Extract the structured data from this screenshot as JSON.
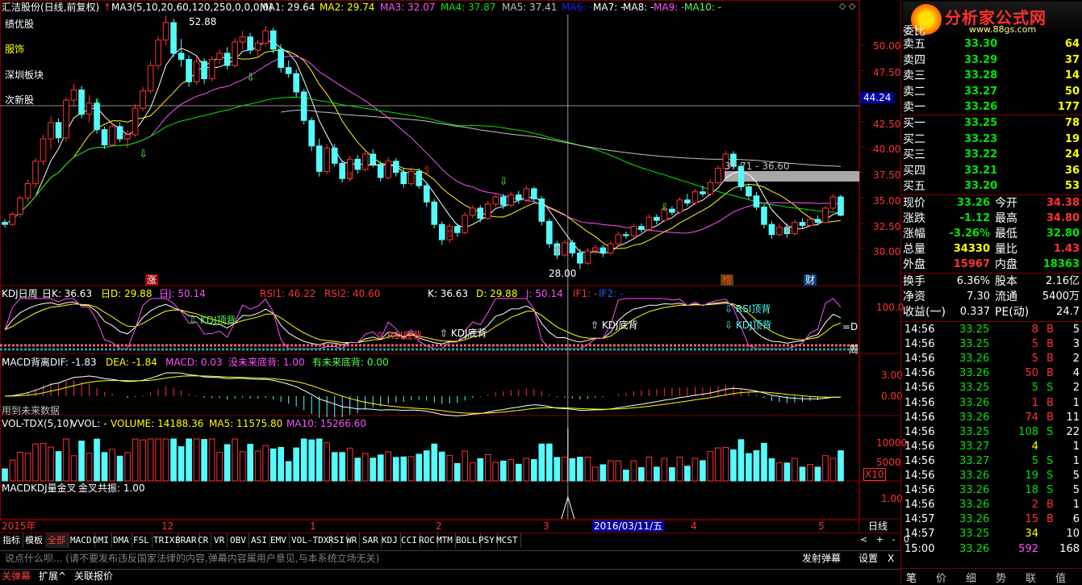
{
  "header": {
    "title": "汇洁股份(日线,前复权)",
    "ma_params": "MA3(5,10,20,60,120,250,0,0,0,0)",
    "ma1": "MA1: 29.64",
    "ma2": "MA2: 29.74",
    "ma3": "MA3: 32.07",
    "ma4": "MA4: 37.87",
    "ma5": "MA5: 37.41",
    "ma6": "MA6: -",
    "ma7": "MA7: -",
    "ma8": "MA8: -",
    "ma9": "MA9: -",
    "ma10": "MA10: -"
  },
  "sectors": [
    "绩优股",
    "服饰",
    "深圳板块",
    "次新股"
  ],
  "price_axis": [
    "50.00",
    "47.50",
    "44.24",
    "42.50",
    "40.00",
    "37.50",
    "35.00",
    "32.50",
    "30.00"
  ],
  "annotations": {
    "high": "52.88",
    "low": "28.00",
    "range": "37.71 - 36.60",
    "zhang": "涨",
    "bang": "榜",
    "cai": "财"
  },
  "kdj": {
    "title": "KDJ日周",
    "k1": "日K: 36.63",
    "d1": "日D: 29.88",
    "j1": "日J: 50.14",
    "rsi1": "RSI1: 46.22",
    "rsi2": "RSI2: 40.60",
    "k2": "K: 36.63",
    "d2": "D: 29.88",
    "j2": "J: 50.14",
    "if1": "IF1: -",
    "if2": "IF2: -",
    "axis": "100.0",
    "signals": [
      "KDJ顶背",
      "RSI底背",
      "KDJ底背",
      "KDJ底背",
      "RSI顶背",
      "KDJ顶背"
    ],
    "right_marks": [
      "=D",
      "周"
    ]
  },
  "macd": {
    "title": "MACD背离",
    "dif": "DIF: -1.83",
    "dea": "DEA: -1.84",
    "macd": "MACD: 0.03",
    "no_future": "没未来底背: 1.00",
    "has_future": "有未来底背: 0.00",
    "axis": [
      "3.00",
      "0.00"
    ],
    "note": "用到未来数据"
  },
  "vol": {
    "title": "VOL-TDX(5,10)",
    "vvol": "VVOL: -",
    "volume": "VOLUME: 14188.36",
    "ma5": "MA5: 11575.80",
    "ma10": "MA10: 15266.60",
    "axis": [
      "10000",
      "5000"
    ],
    "unit": "X10"
  },
  "mkdj": {
    "title": "MACDKDJ量金叉",
    "jc": "金叉共振: 1.00",
    "axis": "1.00"
  },
  "date_axis": {
    "labels": [
      "2015年",
      "12",
      "1",
      "2",
      "3",
      "4",
      "5"
    ],
    "cursor": "2016/03/11/五",
    "period": "日线"
  },
  "tabs": [
    "指标",
    "模板",
    "全部",
    "MACD",
    "DMI",
    "DMA",
    "FSL",
    "TRIX",
    "BRAR",
    "CR",
    "VR",
    "OBV",
    "ASI",
    "EMV",
    "VOL-TDX",
    "RSI",
    "WR",
    "SAR",
    "KDJ",
    "CCI",
    "ROC",
    "MTM",
    "BOLL",
    "PSY",
    "MCST"
  ],
  "tab_controls": [
    "<",
    "+",
    "-",
    "0"
  ],
  "comment": {
    "placeholder": "说点什么呗... (请不要发布违反国家法律的内容,弹幕内容属用户意见,与本系统立场无关)",
    "send": "发射弹幕",
    "settings": "设置",
    "close": "X"
  },
  "bottom_tabs": [
    "关弹幕",
    "扩展^",
    "关联报价"
  ],
  "logo": {
    "brand": "分析家公式网",
    "url": "www.88gs.com"
  },
  "orderbook": {
    "header_label": "委比",
    "sell": [
      {
        "label": "卖五",
        "price": "33.30",
        "vol": "64"
      },
      {
        "label": "卖四",
        "price": "33.29",
        "vol": "37"
      },
      {
        "label": "卖三",
        "price": "33.28",
        "vol": "14"
      },
      {
        "label": "卖二",
        "price": "33.27",
        "vol": "50"
      },
      {
        "label": "卖一",
        "price": "33.26",
        "vol": "177"
      }
    ],
    "buy": [
      {
        "label": "买一",
        "price": "33.25",
        "vol": "78"
      },
      {
        "label": "买二",
        "price": "33.23",
        "vol": "19"
      },
      {
        "label": "买三",
        "price": "33.22",
        "vol": "24"
      },
      {
        "label": "买四",
        "price": "33.21",
        "vol": "36"
      },
      {
        "label": "买五",
        "price": "33.20",
        "vol": "53"
      }
    ]
  },
  "quote": [
    {
      "l1": "现价",
      "v1": "33.26",
      "l2": "今开",
      "v2": "34.38"
    },
    {
      "l1": "涨跌",
      "v1": "-1.12",
      "l2": "最高",
      "v2": "34.80"
    },
    {
      "l1": "涨幅",
      "v1": "-3.26%",
      "l2": "最低",
      "v2": "32.80"
    },
    {
      "l1": "总量",
      "v1": "34330",
      "l2": "量比",
      "v2": "1.43"
    },
    {
      "l1": "外盘",
      "v1": "15967",
      "l2": "内盘",
      "v2": "18363"
    }
  ],
  "fundamentals": [
    {
      "l1": "换手",
      "v1": "6.36%",
      "l2": "股本",
      "v2": "2.16亿"
    },
    {
      "l1": "净资",
      "v1": "7.30",
      "l2": "流通",
      "v2": "5400万"
    },
    {
      "l1": "收益(一)",
      "v1": "0.337",
      "l2": "PE(动)",
      "v2": "24.7"
    }
  ],
  "ticks": [
    {
      "time": "14:56",
      "price": "33.25",
      "vol": "8",
      "side": "B",
      "n": "5"
    },
    {
      "time": "14:56",
      "price": "33.25",
      "vol": "5",
      "side": "B",
      "n": "3"
    },
    {
      "time": "14:56",
      "price": "33.26",
      "vol": "5",
      "side": "B",
      "n": "2"
    },
    {
      "time": "14:56",
      "price": "33.26",
      "vol": "50",
      "side": "B",
      "n": "4"
    },
    {
      "time": "14:56",
      "price": "33.25",
      "vol": "5",
      "side": "S",
      "n": "2"
    },
    {
      "time": "14:56",
      "price": "33.26",
      "vol": "1",
      "side": "B",
      "n": "1"
    },
    {
      "time": "14:56",
      "price": "33.26",
      "vol": "74",
      "side": "B",
      "n": "11"
    },
    {
      "time": "14:56",
      "price": "33.25",
      "vol": "108",
      "side": "S",
      "n": "22"
    },
    {
      "time": "14:56",
      "price": "33.27",
      "vol": "4",
      "side": "",
      "n": "1"
    },
    {
      "time": "14:56",
      "price": "33.27",
      "vol": "5",
      "side": "S",
      "n": "1"
    },
    {
      "time": "14:56",
      "price": "33.26",
      "vol": "19",
      "side": "S",
      "n": "5"
    },
    {
      "time": "14:56",
      "price": "33.26",
      "vol": "18",
      "side": "S",
      "n": "5"
    },
    {
      "time": "14:56",
      "price": "33.26",
      "vol": "2",
      "side": "B",
      "n": "1"
    },
    {
      "time": "14:57",
      "price": "33.26",
      "vol": "15",
      "side": "B",
      "n": "6"
    },
    {
      "time": "14:57",
      "price": "33.25",
      "vol": "34",
      "side": "",
      "n": "10"
    },
    {
      "time": "15:00",
      "price": "33.26",
      "vol": "592",
      "side": "",
      "n": "168"
    }
  ],
  "right_tabs": [
    "笔",
    "价",
    "细",
    "势",
    "联",
    "值"
  ],
  "colors": {
    "up": "#ff3232",
    "down": "#54fcfc",
    "bg": "#000000",
    "grid": "#800000"
  },
  "chart_data": {
    "type": "candlestick",
    "ylim": [
      27.5,
      53
    ],
    "candles": [
      [
        32.6,
        32.9,
        32.1,
        32.4
      ],
      [
        32.4,
        33.6,
        32.2,
        33.4
      ],
      [
        33.4,
        35.2,
        33.1,
        35.0
      ],
      [
        35.0,
        36.8,
        34.6,
        36.4
      ],
      [
        36.4,
        38.9,
        36.0,
        38.6
      ],
      [
        38.6,
        41.2,
        38.2,
        40.8
      ],
      [
        40.8,
        43.0,
        39.8,
        42.4
      ],
      [
        42.4,
        42.8,
        40.4,
        40.9
      ],
      [
        40.9,
        44.9,
        40.5,
        44.6
      ],
      [
        44.6,
        46.2,
        43.9,
        45.6
      ],
      [
        45.6,
        46.0,
        42.8,
        43.2
      ],
      [
        43.2,
        45.1,
        42.4,
        44.3
      ],
      [
        44.3,
        44.6,
        41.3,
        41.7
      ],
      [
        41.7,
        42.0,
        39.8,
        40.2
      ],
      [
        40.2,
        42.4,
        40.0,
        42.0
      ],
      [
        42.0,
        42.4,
        40.5,
        40.8
      ],
      [
        40.8,
        41.7,
        39.9,
        41.2
      ],
      [
        41.2,
        44.2,
        41.0,
        43.8
      ],
      [
        43.8,
        45.9,
        43.5,
        45.5
      ],
      [
        45.5,
        48.4,
        45.2,
        48.0
      ],
      [
        48.0,
        50.9,
        47.6,
        50.5
      ],
      [
        50.5,
        52.9,
        50.0,
        52.2
      ],
      [
        52.2,
        52.6,
        48.8,
        49.2
      ],
      [
        49.2,
        50.6,
        47.9,
        48.6
      ],
      [
        48.6,
        49.0,
        45.9,
        46.4
      ],
      [
        46.4,
        48.9,
        46.1,
        48.4
      ],
      [
        48.4,
        48.7,
        46.2,
        46.7
      ],
      [
        46.7,
        48.9,
        46.4,
        48.6
      ],
      [
        48.6,
        49.6,
        48.1,
        49.2
      ],
      [
        49.2,
        49.8,
        47.6,
        48.0
      ],
      [
        48.0,
        50.7,
        47.8,
        50.3
      ],
      [
        50.3,
        51.4,
        49.6,
        50.8
      ],
      [
        50.8,
        51.2,
        49.1,
        49.5
      ],
      [
        49.5,
        50.5,
        48.9,
        50.2
      ],
      [
        50.2,
        51.9,
        49.9,
        51.4
      ],
      [
        51.4,
        51.7,
        49.2,
        49.6
      ],
      [
        49.6,
        50.1,
        47.3,
        47.8
      ],
      [
        47.8,
        48.5,
        46.8,
        47.2
      ],
      [
        47.2,
        47.6,
        44.9,
        45.4
      ],
      [
        45.4,
        45.7,
        42.2,
        42.6
      ],
      [
        42.6,
        42.9,
        39.6,
        40.1
      ],
      [
        40.1,
        40.8,
        37.1,
        37.6
      ],
      [
        37.6,
        40.3,
        37.3,
        39.9
      ],
      [
        39.9,
        40.3,
        38.1,
        38.4
      ],
      [
        38.4,
        38.7,
        36.5,
        36.9
      ],
      [
        36.9,
        39.1,
        36.6,
        38.8
      ],
      [
        38.8,
        39.2,
        37.4,
        37.8
      ],
      [
        37.8,
        39.6,
        37.6,
        39.3
      ],
      [
        39.3,
        39.8,
        38.0,
        38.3
      ],
      [
        38.3,
        38.6,
        36.6,
        37.0
      ],
      [
        37.0,
        39.0,
        36.8,
        38.6
      ],
      [
        38.6,
        38.9,
        37.1,
        37.5
      ],
      [
        37.5,
        37.9,
        36.0,
        36.4
      ],
      [
        36.4,
        38.0,
        36.2,
        37.6
      ],
      [
        37.6,
        37.9,
        35.9,
        36.2
      ],
      [
        36.2,
        36.5,
        34.1,
        34.6
      ],
      [
        34.6,
        34.9,
        32.0,
        32.4
      ],
      [
        32.4,
        32.7,
        30.4,
        30.9
      ],
      [
        30.9,
        32.5,
        30.6,
        32.2
      ],
      [
        32.2,
        32.5,
        31.2,
        31.6
      ],
      [
        31.6,
        33.6,
        31.4,
        33.3
      ],
      [
        33.3,
        34.3,
        33.0,
        34.0
      ],
      [
        34.0,
        34.3,
        32.6,
        33.0
      ],
      [
        33.0,
        34.7,
        32.8,
        34.4
      ],
      [
        34.4,
        35.5,
        34.1,
        35.1
      ],
      [
        35.1,
        35.4,
        33.9,
        34.3
      ],
      [
        34.3,
        35.6,
        34.1,
        35.3
      ],
      [
        35.3,
        35.7,
        34.4,
        34.8
      ],
      [
        34.8,
        36.2,
        34.6,
        35.9
      ],
      [
        35.9,
        36.1,
        34.6,
        34.9
      ],
      [
        34.9,
        35.2,
        32.3,
        32.7
      ],
      [
        32.7,
        33.0,
        30.1,
        30.5
      ],
      [
        30.5,
        30.8,
        29.0,
        29.4
      ],
      [
        29.4,
        30.9,
        29.2,
        30.6
      ],
      [
        30.6,
        30.9,
        29.2,
        29.6
      ],
      [
        29.6,
        30.0,
        28.0,
        28.6
      ],
      [
        28.6,
        30.1,
        28.4,
        29.8
      ],
      [
        29.8,
        30.4,
        29.4,
        30.1
      ],
      [
        30.1,
        30.4,
        29.2,
        29.6
      ],
      [
        29.6,
        30.8,
        29.4,
        30.5
      ],
      [
        30.5,
        31.7,
        30.3,
        31.4
      ],
      [
        31.4,
        31.7,
        31.0,
        31.3
      ],
      [
        31.3,
        32.5,
        31.1,
        32.2
      ],
      [
        32.2,
        32.5,
        31.6,
        31.9
      ],
      [
        31.9,
        33.4,
        31.7,
        33.1
      ],
      [
        33.1,
        33.4,
        32.4,
        32.8
      ],
      [
        32.8,
        34.2,
        32.6,
        33.9
      ],
      [
        33.9,
        34.2,
        33.3,
        33.6
      ],
      [
        33.6,
        35.1,
        33.4,
        34.8
      ],
      [
        34.8,
        35.4,
        34.2,
        34.5
      ],
      [
        34.5,
        35.9,
        34.3,
        35.6
      ],
      [
        35.6,
        36.2,
        35.1,
        35.4
      ],
      [
        35.4,
        36.8,
        35.2,
        36.5
      ],
      [
        36.5,
        38.2,
        36.3,
        37.9
      ],
      [
        37.9,
        39.6,
        37.6,
        39.3
      ],
      [
        39.3,
        39.6,
        37.8,
        38.1
      ],
      [
        38.1,
        38.4,
        35.7,
        36.1
      ],
      [
        36.1,
        36.4,
        34.9,
        35.2
      ],
      [
        35.2,
        35.6,
        33.8,
        34.1
      ],
      [
        34.1,
        34.4,
        32.0,
        32.4
      ],
      [
        32.4,
        32.7,
        31.0,
        31.4
      ],
      [
        31.4,
        32.5,
        31.2,
        32.1
      ],
      [
        32.1,
        32.5,
        31.1,
        31.5
      ],
      [
        31.5,
        32.9,
        31.3,
        32.6
      ],
      [
        32.6,
        33.0,
        32.0,
        32.3
      ],
      [
        32.3,
        33.2,
        32.1,
        32.9
      ],
      [
        32.9,
        33.3,
        32.3,
        32.6
      ],
      [
        32.6,
        34.2,
        32.5,
        34.0
      ],
      [
        34.0,
        35.4,
        33.8,
        35.1
      ],
      [
        35.1,
        35.3,
        33.2,
        33.3
      ]
    ]
  }
}
